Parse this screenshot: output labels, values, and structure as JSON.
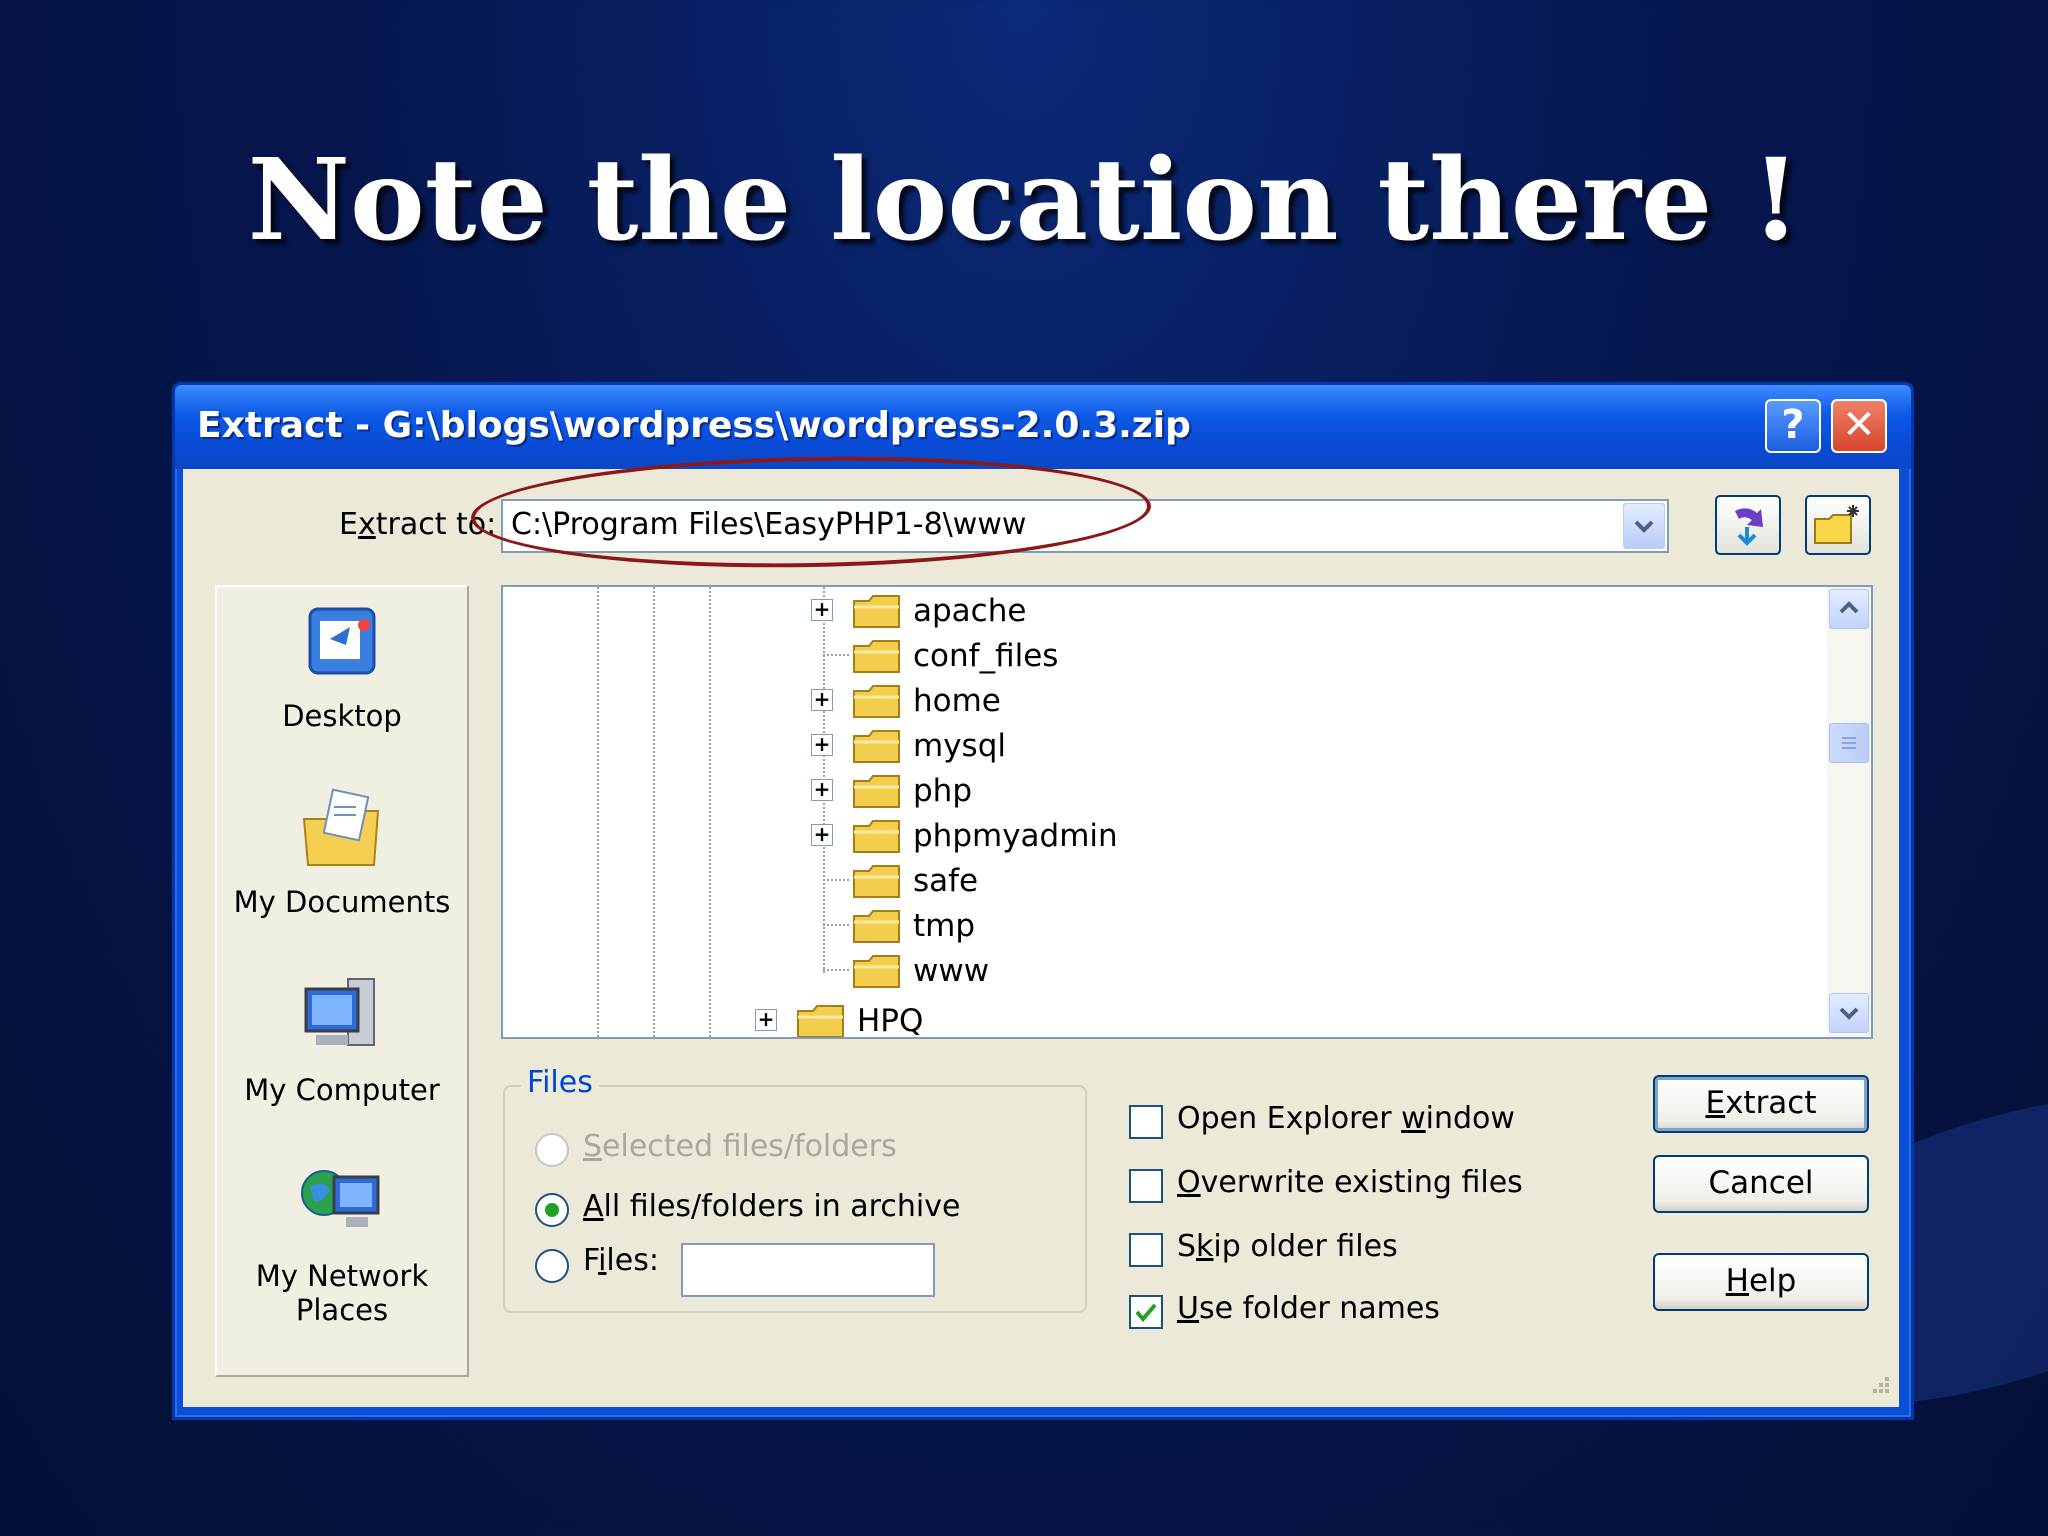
{
  "slide": {
    "title": "Note the location there !"
  },
  "dialog": {
    "title": "Extract - G:\\blogs\\wordpress\\wordpress-2.0.3.zip",
    "help_btn": "?",
    "close_btn": "✕",
    "extract_to": {
      "label_pre": "E",
      "label_u": "x",
      "label_post": "tract to:",
      "value": "C:\\Program Files\\EasyPHP1-8\\www"
    },
    "places": [
      "Desktop",
      "My Documents",
      "My Computer",
      "My Network",
      "Places"
    ],
    "tree": [
      {
        "name": "apache",
        "expandable": true
      },
      {
        "name": "conf_files",
        "expandable": false
      },
      {
        "name": "home",
        "expandable": true
      },
      {
        "name": "mysql",
        "expandable": true
      },
      {
        "name": "php",
        "expandable": true
      },
      {
        "name": "phpmyadmin",
        "expandable": true
      },
      {
        "name": "safe",
        "expandable": false
      },
      {
        "name": "tmp",
        "expandable": false
      },
      {
        "name": "www",
        "expandable": false
      },
      {
        "name": "HPQ",
        "expandable": true
      }
    ],
    "files_group": {
      "title": "Files",
      "opt_selected": {
        "u": "S",
        "rest": "elected files/folders"
      },
      "opt_all": {
        "u": "A",
        "rest": "ll files/folders in archive"
      },
      "opt_files": {
        "pre": "F",
        "u": "i",
        "rest": "les:"
      },
      "files_value": ""
    },
    "options": {
      "open_explorer": {
        "pre": "Open Explorer ",
        "u": "w",
        "rest": "indow"
      },
      "overwrite": {
        "pre": "",
        "u": "O",
        "rest": "verwrite existing files"
      },
      "skip_older": {
        "pre": "S",
        "u": "k",
        "rest": "ip older files"
      },
      "use_folder": {
        "pre": "",
        "u": "U",
        "rest": "se folder names"
      }
    },
    "buttons": {
      "extract": {
        "u": "E",
        "rest": "xtract"
      },
      "cancel": "Cancel",
      "help": {
        "u": "H",
        "rest": "elp"
      }
    },
    "colors": {
      "titlebar": "#0a4cd6",
      "face": "#ece9d8",
      "link": "#0046d5",
      "annotation": "#8a1818"
    }
  }
}
